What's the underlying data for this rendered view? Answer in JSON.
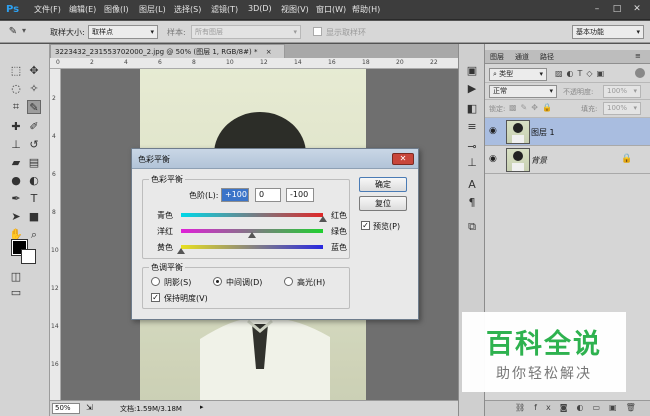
{
  "app": {
    "logo": "Ps"
  },
  "menu": [
    "文件(F)",
    "编辑(E)",
    "图像(I)",
    "图层(L)",
    "选择(S)",
    "滤镜(T)",
    "3D(D)",
    "视图(V)",
    "窗口(W)",
    "帮助(H)"
  ],
  "window_controls": {
    "minimize": "–",
    "maximize": "□",
    "close": "✕"
  },
  "options_bar": {
    "sample_size_label": "取样大小:",
    "sample_size_value": "取样点",
    "sample_label": "样本:",
    "sample_value": "所有图层",
    "show_ring_label": "显示取样环",
    "workspace": "基本功能"
  },
  "document": {
    "tab_title": "3223432_231553702000_2.jpg @ 50% (图层 1, RGB/8#) *",
    "tab_close": "×",
    "zoom": "50%",
    "doc_info": "文档:1.59M/3.18M",
    "ruler_h": [
      "0",
      "2",
      "4",
      "6",
      "8",
      "10",
      "12",
      "14",
      "16",
      "18",
      "20",
      "22"
    ],
    "ruler_v": [
      "2",
      "4",
      "6",
      "8",
      "10",
      "12",
      "14",
      "16"
    ]
  },
  "layers_panel": {
    "tabs": [
      "图层",
      "通道",
      "路径"
    ],
    "kind_filter": "类型",
    "blend_mode": "正常",
    "opacity_label": "不透明度:",
    "opacity_value": "100%",
    "lock_label": "锁定:",
    "fill_label": "填充:",
    "fill_value": "100%",
    "layers": [
      {
        "name": "图层 1",
        "selected": true
      },
      {
        "name": "背景",
        "selected": false,
        "locked": true
      }
    ],
    "bottom_icons": [
      "link-icon",
      "fx-icon",
      "mask-icon",
      "adjustment-icon",
      "folder-icon",
      "new-layer-icon",
      "trash-icon"
    ]
  },
  "dialog": {
    "title": "色彩平衡",
    "close": "✕",
    "group_color_balance": "色彩平衡",
    "levels_label": "色阶(L):",
    "levels": [
      "+100",
      "0",
      "-100"
    ],
    "sliders": [
      {
        "left": "青色",
        "right": "红色",
        "value": 100
      },
      {
        "left": "洋红",
        "right": "绿色",
        "value": 0
      },
      {
        "left": "黄色",
        "right": "蓝色",
        "value": -100
      }
    ],
    "ok": "确定",
    "reset": "复位",
    "preview_label": "预览(P)",
    "preview_checked": true,
    "group_tone": "色调平衡",
    "tone_options": [
      "阴影(S)",
      "中间调(D)",
      "高光(H)"
    ],
    "tone_selected": 1,
    "preserve_luminosity": "保持明度(V)",
    "preserve_checked": true
  },
  "watermark": {
    "title": "百科全说",
    "subtitle": "助你轻松解决"
  }
}
